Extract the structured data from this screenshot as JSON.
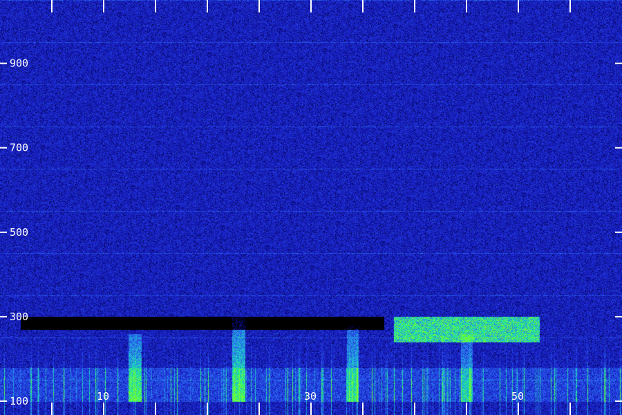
{
  "chart_data": {
    "type": "heatmap",
    "title": "",
    "xlabel": "",
    "ylabel": "",
    "x_range": [
      0,
      60
    ],
    "y_range": [
      100,
      1050
    ],
    "x_ticks": [
      5,
      10,
      15,
      20,
      25,
      30,
      35,
      40,
      45,
      50,
      55
    ],
    "x_tick_labels": [
      {
        "value": 10,
        "text": "10"
      },
      {
        "value": 30,
        "text": "30"
      },
      {
        "value": 50,
        "text": "50"
      }
    ],
    "y_ticks": [
      100,
      300,
      500,
      700,
      900
    ],
    "y_tick_labels": [
      {
        "value": 100,
        "text": "100"
      },
      {
        "value": 300,
        "text": "300"
      },
      {
        "value": 500,
        "text": "500"
      },
      {
        "value": 700,
        "text": "700"
      },
      {
        "value": 900,
        "text": "900"
      }
    ],
    "colormap": [
      "#000000",
      "#0a0a8c",
      "#1f2ad6",
      "#2a6ef0",
      "#1fbfd6",
      "#1ff08a",
      "#7cff2a"
    ],
    "background_color": "#0a0a8c",
    "grid": false,
    "features": [
      {
        "kind": "low-frequency energy",
        "x_range": [
          0,
          60
        ],
        "y_range": [
          100,
          180
        ],
        "intensity": 0.55
      },
      {
        "kind": "dark band",
        "x_range": [
          2,
          37
        ],
        "y_range": [
          270,
          300
        ],
        "intensity": -0.6
      },
      {
        "kind": "bright blob",
        "x_range": [
          38,
          52
        ],
        "y_range": [
          240,
          300
        ],
        "intensity": 0.95
      },
      {
        "kind": "bright column",
        "x": 13,
        "y_range": [
          100,
          260
        ],
        "intensity": 0.7
      },
      {
        "kind": "bright column",
        "x": 23,
        "y_range": [
          100,
          300
        ],
        "intensity": 0.7
      },
      {
        "kind": "bright column",
        "x": 34,
        "y_range": [
          100,
          280
        ],
        "intensity": 0.6
      },
      {
        "kind": "bright column",
        "x": 45,
        "y_range": [
          100,
          260
        ],
        "intensity": 0.5
      }
    ]
  }
}
